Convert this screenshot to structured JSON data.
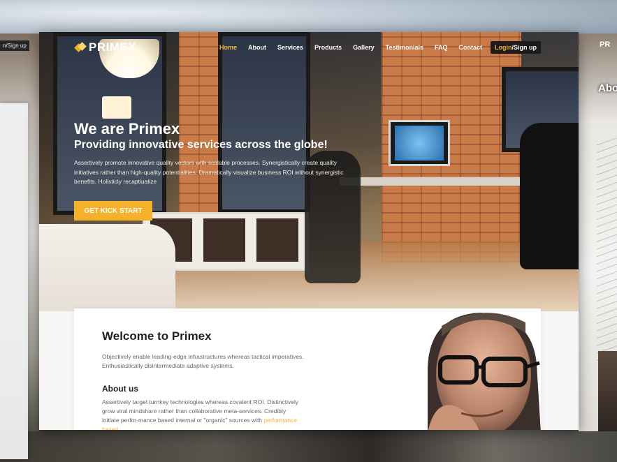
{
  "brand": {
    "name": "PRIMEX",
    "accent": "#f5b12a"
  },
  "nav": {
    "items": [
      "Home",
      "About",
      "Services",
      "Products",
      "Gallery",
      "Testimonials",
      "FAQ",
      "Contact"
    ],
    "active": "Home",
    "login_label": "Login",
    "signup_label": "/Sign up"
  },
  "hero": {
    "title": "We are Primex",
    "subtitle": "Providing innovative services across the globe!",
    "paragraph": "Assertively promote innovative quality vectors with scalable processes. Synergistically create quality initiatives rather than high-quality potentialities. Dramatically visualize business ROI without synergistic benefits. Holisticly recaptiualize",
    "cta_label": "GET KICK START"
  },
  "welcome": {
    "title": "Welcome to Primex",
    "paragraph": "Objectively enable leading-edge infrastructures whereas tactical imperatives. Enthusiastically disintermediate adaptive systems."
  },
  "about": {
    "title": "About us",
    "paragraph": "Assertively target turnkey technologies whereas covalent ROI. Distinctively grow viral mindshare rather than collaborative meta-services. Credibly initiate perfor-mance based internal or \"organic\" sources with",
    "link_text": "performance based"
  },
  "side_left": {
    "tag": "n/Sign up"
  },
  "side_right": {
    "logo": "PR",
    "heading": "Abo"
  }
}
